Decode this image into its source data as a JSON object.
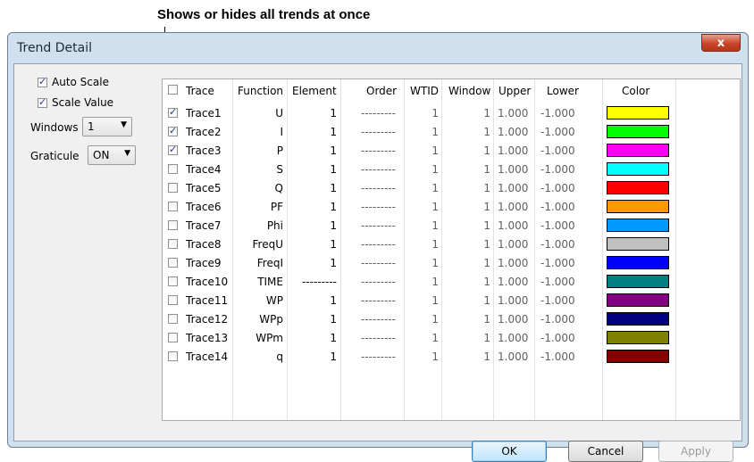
{
  "annotation": "Shows or hides all trends at once",
  "window": {
    "title": "Trend Detail",
    "close_label": "x"
  },
  "options": {
    "auto_scale": {
      "label": "Auto Scale",
      "checked": true
    },
    "scale_value": {
      "label": "Scale Value",
      "checked": true
    },
    "windows": {
      "label": "Windows",
      "value": "1"
    },
    "graticule": {
      "label": "Graticule",
      "value": "ON"
    }
  },
  "table": {
    "header_checkbox_checked": false,
    "columns": [
      "Trace",
      "Function",
      "Element",
      "Order",
      "WTID",
      "Window",
      "Upper",
      "Lower",
      "Color"
    ],
    "rows": [
      {
        "trace": "Trace1",
        "checked": true,
        "function": "U",
        "element": "1",
        "order": "---------",
        "wtid": "1",
        "window": "1",
        "upper": "1.000",
        "lower": "-1.000",
        "color": "#ffff00"
      },
      {
        "trace": "Trace2",
        "checked": true,
        "function": "I",
        "element": "1",
        "order": "---------",
        "wtid": "1",
        "window": "1",
        "upper": "1.000",
        "lower": "-1.000",
        "color": "#00ff00"
      },
      {
        "trace": "Trace3",
        "checked": true,
        "function": "P",
        "element": "1",
        "order": "---------",
        "wtid": "1",
        "window": "1",
        "upper": "1.000",
        "lower": "-1.000",
        "color": "#ff00ff"
      },
      {
        "trace": "Trace4",
        "checked": false,
        "function": "S",
        "element": "1",
        "order": "---------",
        "wtid": "1",
        "window": "1",
        "upper": "1.000",
        "lower": "-1.000",
        "color": "#00ffff"
      },
      {
        "trace": "Trace5",
        "checked": false,
        "function": "Q",
        "element": "1",
        "order": "---------",
        "wtid": "1",
        "window": "1",
        "upper": "1.000",
        "lower": "-1.000",
        "color": "#ff0000"
      },
      {
        "trace": "Trace6",
        "checked": false,
        "function": "PF",
        "element": "1",
        "order": "---------",
        "wtid": "1",
        "window": "1",
        "upper": "1.000",
        "lower": "-1.000",
        "color": "#ff9900"
      },
      {
        "trace": "Trace7",
        "checked": false,
        "function": "Phi",
        "element": "1",
        "order": "---------",
        "wtid": "1",
        "window": "1",
        "upper": "1.000",
        "lower": "-1.000",
        "color": "#0099ff"
      },
      {
        "trace": "Trace8",
        "checked": false,
        "function": "FreqU",
        "element": "1",
        "order": "---------",
        "wtid": "1",
        "window": "1",
        "upper": "1.000",
        "lower": "-1.000",
        "color": "#c0c0c0"
      },
      {
        "trace": "Trace9",
        "checked": false,
        "function": "FreqI",
        "element": "1",
        "order": "---------",
        "wtid": "1",
        "window": "1",
        "upper": "1.000",
        "lower": "-1.000",
        "color": "#0000ff"
      },
      {
        "trace": "Trace10",
        "checked": false,
        "function": "TIME",
        "element": "---------",
        "order": "---------",
        "wtid": "1",
        "window": "1",
        "upper": "1.000",
        "lower": "-1.000",
        "color": "#008080"
      },
      {
        "trace": "Trace11",
        "checked": false,
        "function": "WP",
        "element": "1",
        "order": "---------",
        "wtid": "1",
        "window": "1",
        "upper": "1.000",
        "lower": "-1.000",
        "color": "#800080"
      },
      {
        "trace": "Trace12",
        "checked": false,
        "function": "WPp",
        "element": "1",
        "order": "---------",
        "wtid": "1",
        "window": "1",
        "upper": "1.000",
        "lower": "-1.000",
        "color": "#000080"
      },
      {
        "trace": "Trace13",
        "checked": false,
        "function": "WPm",
        "element": "1",
        "order": "---------",
        "wtid": "1",
        "window": "1",
        "upper": "1.000",
        "lower": "-1.000",
        "color": "#808000"
      },
      {
        "trace": "Trace14",
        "checked": false,
        "function": "q",
        "element": "1",
        "order": "---------",
        "wtid": "1",
        "window": "1",
        "upper": "1.000",
        "lower": "-1.000",
        "color": "#800000"
      }
    ]
  },
  "buttons": {
    "ok": "OK",
    "cancel": "Cancel",
    "apply": "Apply"
  }
}
